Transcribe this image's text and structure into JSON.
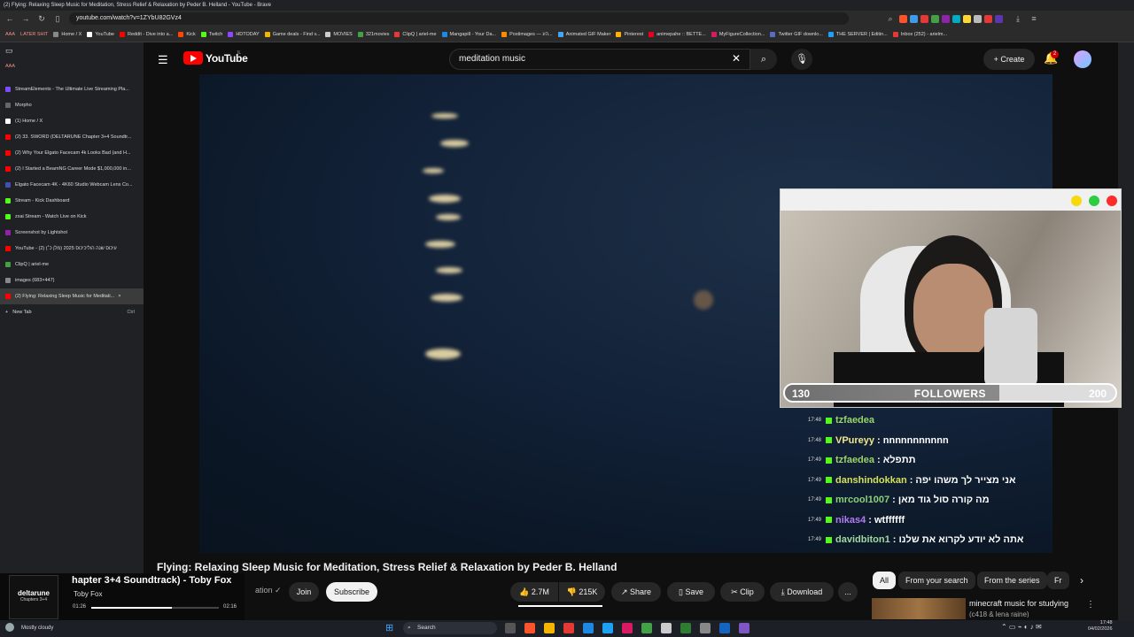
{
  "window": {
    "title": "(2) Flying: Relaxing Sleep Music for Meditation, Stress Relief & Relaxation by Peder B. Helland - YouTube - Brave"
  },
  "browser": {
    "url": "youtube.com/watch?v=1ZYbU82GVz4"
  },
  "bookmarks": [
    "AAA",
    "LATER SHIT",
    "Home / X",
    "YouTube",
    "Reddit - Dive into a...",
    "Kick",
    "Twitch",
    "HDTODAY",
    "Game deals - Find v...",
    "MOVIES",
    "321movies",
    "ClipQ | ariel-me",
    "Mangapill - Your Da...",
    "Postimages — הע...",
    "Animated GIF Maker",
    "Pinterest",
    "animepahe :: BETTE...",
    "MyFigureCollection...",
    "Twitter GIF downlo...",
    "THE SERVER | Editin...",
    "Inbox (252) - arielm..."
  ],
  "tabs": {
    "group": "AAA",
    "items": [
      "StreamElements - The Ultimate Live Streaming Pla...",
      "Morpho",
      "(1) Home / X",
      "(2) 33. SWORD (DELTARUNE Chapter 3+4 Soundtr...",
      "(2) Why Your Elgato Facecam 4k Looks Bad (and H...",
      "(2) I Started a BeamNG Career Mode $1,000,000 in...",
      "Elgato Facecam 4K - 4K60 Studio Webcam Lens Co...",
      "Stream - Kick Dashboard",
      "zxai Stream - Watch Live on Kick",
      "Screenshot by Lightshot",
      "YouTube - (2) עיכוס שנה הוליכיכוס 2025 (מלן כ׳)",
      "ClipQ | ariel-me",
      "images (683×447)",
      "(2) Flying: Relaxing Sleep Music for Meditati..."
    ],
    "new_tab": "New Tab",
    "new_tab_shortcut": "Ctrl"
  },
  "youtube": {
    "logo": "YouTube",
    "country": "IL",
    "search_query": "meditation music",
    "create_label": "Create",
    "notif_count": "2"
  },
  "overlay": {
    "followers_current": "130",
    "followers_label": "FOLLOWERS",
    "followers_goal": "200",
    "followers_fraction": 0.65,
    "chat": [
      {
        "time": "17:48",
        "user": "tzfaedea",
        "text": "",
        "color": "#9ad46a"
      },
      {
        "time": "17:48",
        "user": "VPureyy",
        "text": ": nnnnnnnnnnn",
        "color": "#f0e78a"
      },
      {
        "time": "17:49",
        "user": "tzfaedea",
        "text": ": תתפלא",
        "color": "#9ad46a"
      },
      {
        "time": "17:49",
        "user": "danshindokkan",
        "text": ": אני מצייר לך משהו יפה",
        "color": "#d6e05c"
      },
      {
        "time": "17:49",
        "user": "mrcool1007",
        "text": ": מה קורה סול גוד מאן",
        "color": "#8ad17b"
      },
      {
        "time": "17:49",
        "user": "nikas4",
        "text": ": wtffffff",
        "color": "#b27cf3"
      },
      {
        "time": "17:49",
        "user": "davidbiton1",
        "text": ": אתה לא יודע לקרוא את שלנו",
        "color": "#a0d8a0"
      }
    ]
  },
  "video": {
    "title": "Flying: Relaxing Sleep Music for Meditation, Stress Relief & Relaxation by Peder B. Helland",
    "channel_suffix": "ation",
    "join": "Join",
    "subscribe": "Subscribe",
    "likes": "2.7M",
    "dislikes": "215K",
    "share": "Share",
    "save": "Save",
    "clip": "Clip",
    "download": "Download",
    "more": "..."
  },
  "chips": [
    "All",
    "From your search",
    "From the series",
    "Fr"
  ],
  "recommended": {
    "title": "minecraft music for studying",
    "subtitle": "(c418 & lena raine)"
  },
  "miniplayer": {
    "art_label": "deltarune",
    "art_sub": "Chapters 3+4",
    "title": "hapter 3+4 Soundtrack) - Toby Fox",
    "artist": "Toby Fox",
    "elapsed": "01:26",
    "duration": "02:16",
    "progress": 0.63
  },
  "taskbar": {
    "weather": "Mostly cloudy",
    "search": "Search",
    "time": "17:48",
    "date": "04/02/2026"
  }
}
